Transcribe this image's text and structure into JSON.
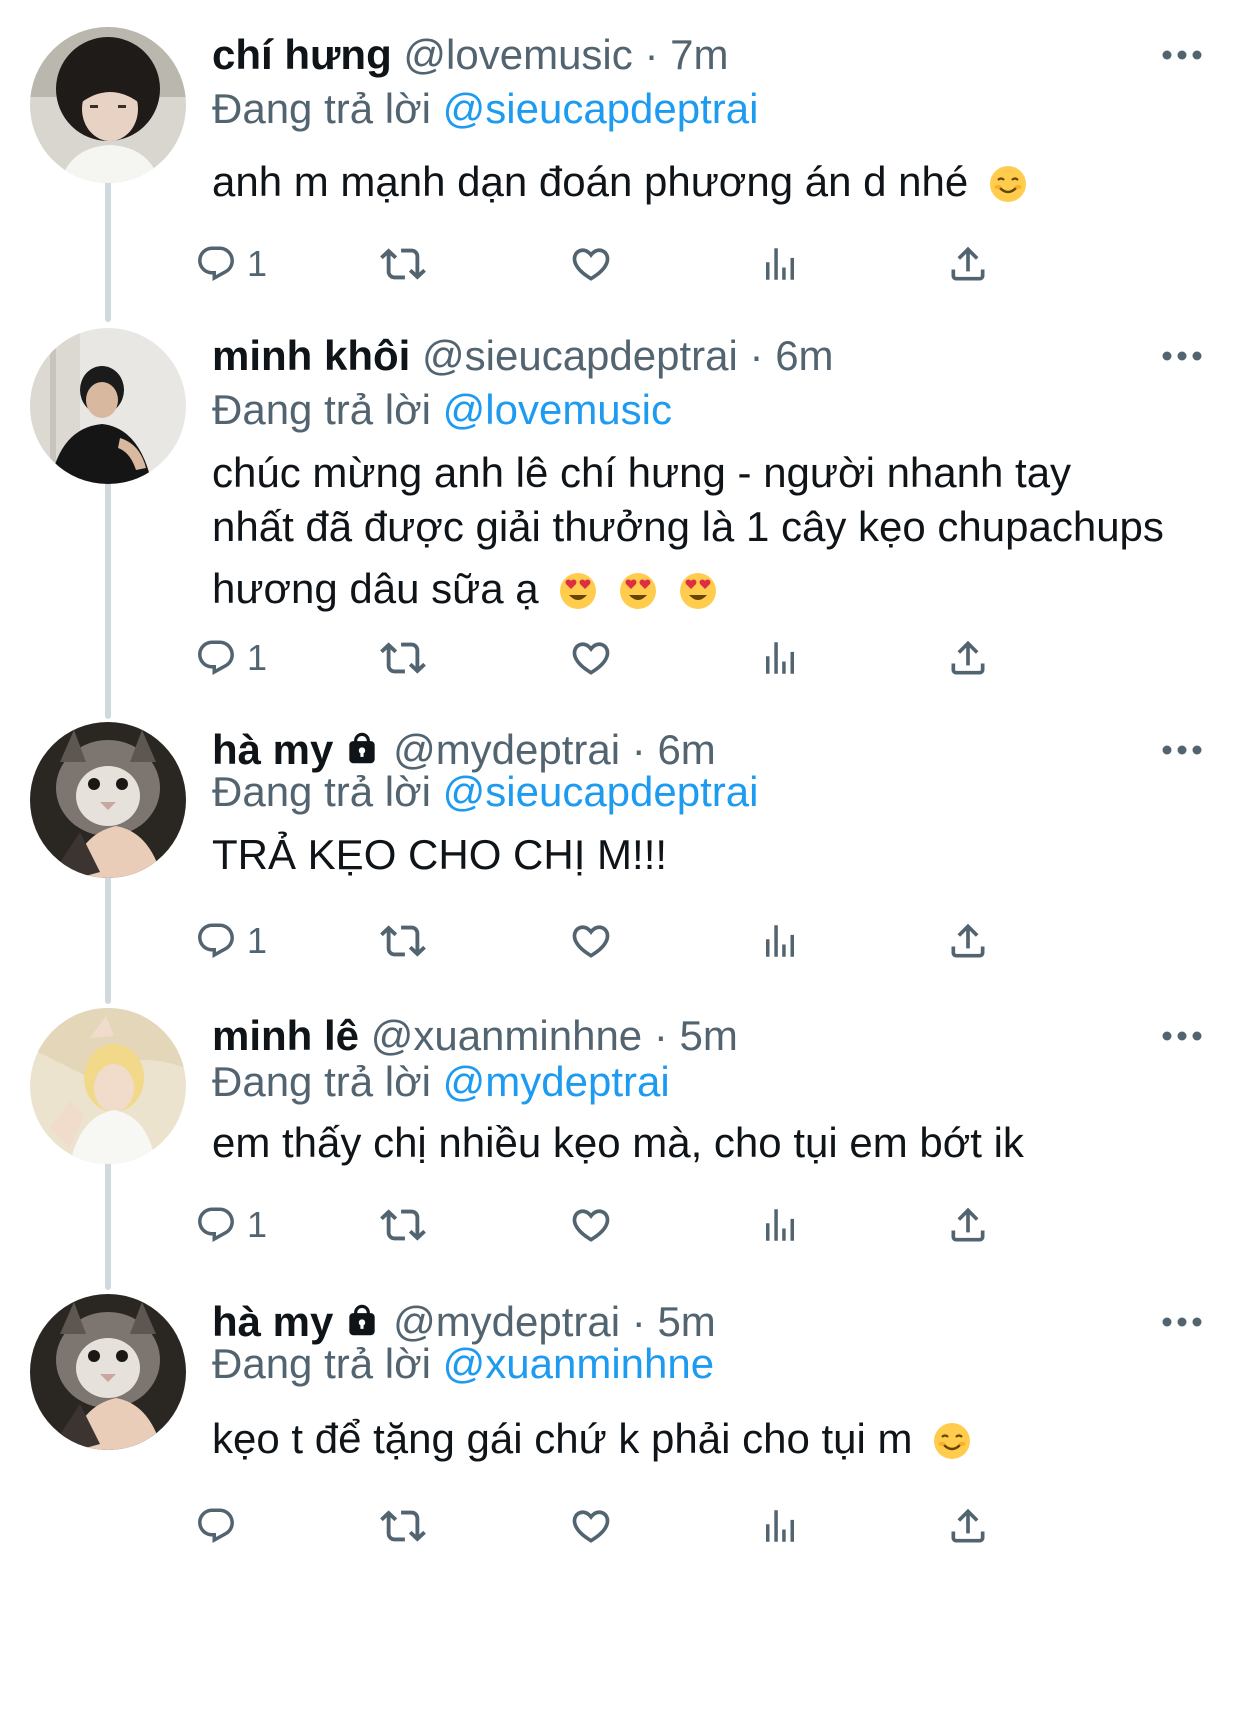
{
  "colors": {
    "link": "#1d9bf0",
    "secondary": "#536471",
    "text": "#0f1419",
    "connector": "#cfd9de"
  },
  "icons": [
    "more-icon",
    "reply-icon",
    "retweet-icon",
    "like-icon",
    "views-icon",
    "share-icon",
    "lock-icon",
    "emoji-icon"
  ],
  "tweets": [
    {
      "name": "chí hưng",
      "handle": "@lovemusic",
      "sep": "·",
      "time": "7m",
      "reply_prefix": "Đang trả lời",
      "reply_to": "@sieucapdeptrai",
      "lines": [
        "anh m mạnh dạn đoán phương án d nhé"
      ],
      "emoji": [
        "smiling-face"
      ],
      "reply_count": "1"
    },
    {
      "name": "minh khôi",
      "handle": "@sieucapdeptrai",
      "sep": "·",
      "time": "6m",
      "reply_prefix": "Đang trả lời",
      "reply_to": "@lovemusic",
      "lines": [
        "chúc mừng anh lê chí hưng - người nhanh tay",
        "nhất đã được giải thưởng là 1 cây kẹo chupachups",
        "hương dâu sữa ạ"
      ],
      "emoji": [
        "heart-eyes",
        "heart-eyes",
        "heart-eyes"
      ],
      "reply_count": "1"
    },
    {
      "name": "hà my",
      "handle": "@mydeptrai",
      "sep": "·",
      "time": "6m",
      "reply_prefix": "Đang trả lời",
      "reply_to": "@sieucapdeptrai",
      "lines": [
        "TRẢ KẸO CHO CHỊ M!!!"
      ],
      "reply_count": "1"
    },
    {
      "name": "minh lê",
      "handle": "@xuanminhne",
      "sep": "·",
      "time": "5m",
      "reply_prefix": "Đang trả lời",
      "reply_to": "@mydeptrai",
      "lines": [
        "em thấy chị nhiều kẹo mà, cho tụi em bớt ik"
      ],
      "reply_count": "1"
    },
    {
      "name": "hà my",
      "handle": "@mydeptrai",
      "sep": "·",
      "time": "5m",
      "reply_prefix": "Đang trả lời",
      "reply_to": "@xuanminhne",
      "lines": [
        "kẹo t để tặng gái chứ k phải cho tụi m"
      ],
      "emoji": [
        "smiling-face"
      ],
      "reply_count": ""
    }
  ]
}
